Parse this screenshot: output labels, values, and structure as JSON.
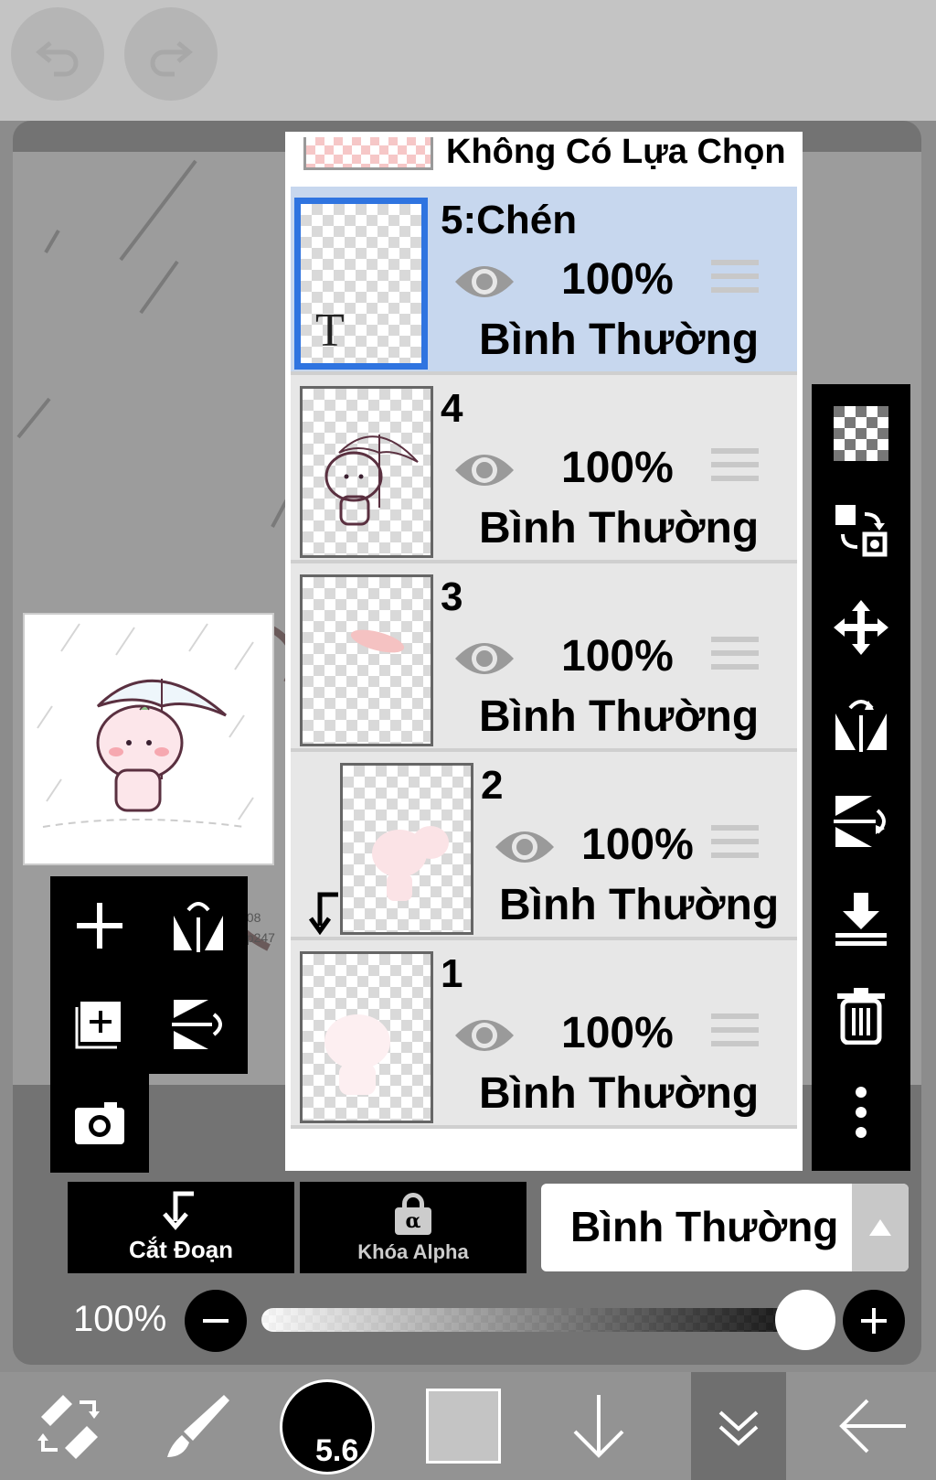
{
  "top": {
    "undo_icon": "undo-icon",
    "redo_icon": "redo-icon"
  },
  "layer_panel": {
    "no_selection_label": "Không Có Lựa Chọn",
    "layers": [
      {
        "name": "5:Chén",
        "opacity": "100%",
        "mode": "Bình Thường",
        "selected": true,
        "text_layer_glyph": "T"
      },
      {
        "name": "4",
        "opacity": "100%",
        "mode": "Bình Thường",
        "selected": false
      },
      {
        "name": "3",
        "opacity": "100%",
        "mode": "Bình Thường",
        "selected": false
      },
      {
        "name": "2",
        "opacity": "100%",
        "mode": "Bình Thường",
        "selected": false,
        "clipped": true
      },
      {
        "name": "1",
        "opacity": "100%",
        "mode": "Bình Thường",
        "selected": false
      }
    ]
  },
  "right_tools": [
    "transparency-icon",
    "swap-layer-icon",
    "move-icon",
    "flip-horizontal-icon",
    "flip-vertical-icon",
    "merge-down-icon",
    "trash-icon",
    "more-icon"
  ],
  "left_tools": [
    "add-layer-icon",
    "flip-horizontal-icon",
    "add-copy-layer-icon",
    "flip-vertical-icon",
    "camera-icon"
  ],
  "controls": {
    "clip_label": "Cắt Đoạn",
    "alpha_lock_label": "Khóa Alpha",
    "alpha_glyph": "α",
    "blend_mode": "Bình Thường",
    "opacity_label": "100%",
    "opacity_value": 1.0
  },
  "bottom_bar": {
    "brush_size": "5.6",
    "color": "#c4c4c4"
  }
}
